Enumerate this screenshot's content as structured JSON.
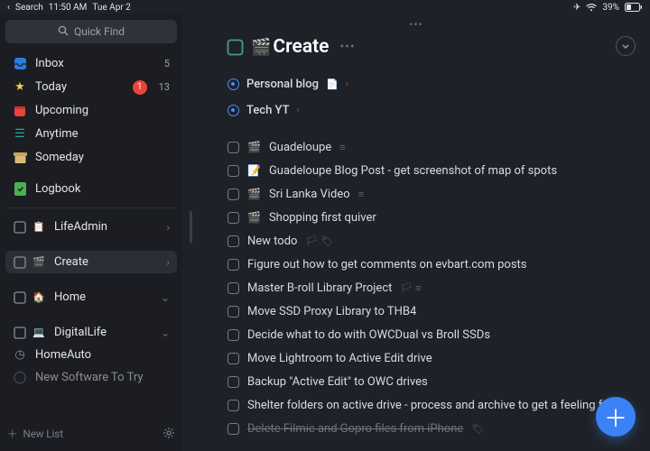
{
  "statusbar": {
    "back_label": "Search",
    "time": "11:50 AM",
    "date": "Tue Apr 2",
    "battery": "39%"
  },
  "sidebar": {
    "quickfind": "Quick Find",
    "primary": [
      {
        "icon": "📥",
        "label": "Inbox",
        "count": "5"
      },
      {
        "icon": "★",
        "label": "Today",
        "badge": "1",
        "count": "13"
      },
      {
        "icon": "📅",
        "label": "Upcoming"
      },
      {
        "icon": "≣",
        "label": "Anytime"
      },
      {
        "icon": "🗄",
        "label": "Someday"
      }
    ],
    "logbook": {
      "icon": "📗",
      "label": "Logbook"
    },
    "areas": [
      {
        "icon": "▦",
        "label": "LifeAdmin",
        "chev": "›"
      },
      {
        "icon": "🎬",
        "label": "Create",
        "chev": "›",
        "selected": true
      },
      {
        "icon": "🏠",
        "label": "Home",
        "chev": "⌄"
      },
      {
        "icon": "💻",
        "label": "DigitalLife",
        "chev": "⌄"
      }
    ],
    "subs": [
      {
        "icon": "◷",
        "label": "HomeAuto"
      },
      {
        "icon": "◯",
        "label": "New Software To Try"
      }
    ],
    "newlist": "New List"
  },
  "header": {
    "title": "Create",
    "ellipsis": "•••"
  },
  "subheads": [
    {
      "label": "Personal blog",
      "extras": [
        "📄",
        "›"
      ]
    },
    {
      "label": "Tech YT",
      "extras": [
        "›"
      ]
    }
  ],
  "tasks": [
    {
      "icon": "🎬",
      "label": "Guadeloupe",
      "meta": [
        "≡"
      ]
    },
    {
      "icon": "📝",
      "label": "Guadeloupe Blog Post - get screenshot of map of spots"
    },
    {
      "icon": "🎬",
      "label": "Sri Lanka Video",
      "meta": [
        "≡"
      ]
    },
    {
      "icon": "🎬",
      "label": "Shopping first quiver"
    },
    {
      "label": "New todo",
      "meta": [
        "🏳",
        "🏷"
      ]
    },
    {
      "label": "Figure out how to get comments on evbart.com posts"
    },
    {
      "label": "Master B-roll Library Project",
      "meta": [
        "🏳",
        "≡"
      ]
    },
    {
      "label": "Move SSD Proxy Library to THB4"
    },
    {
      "label": "Decide what to do with OWCDual vs Broll SSDs"
    },
    {
      "label": "Move Lightroom to Active Edit drive"
    },
    {
      "label": "Backup \"Active Edit\" to OWC drives"
    },
    {
      "label": "Shelter folders on active drive - process and archive to get a feeling for the step…"
    },
    {
      "label": "Delete Filmic and Gopro files from iPhone",
      "meta": [
        "🏷"
      ],
      "struck": true
    }
  ]
}
